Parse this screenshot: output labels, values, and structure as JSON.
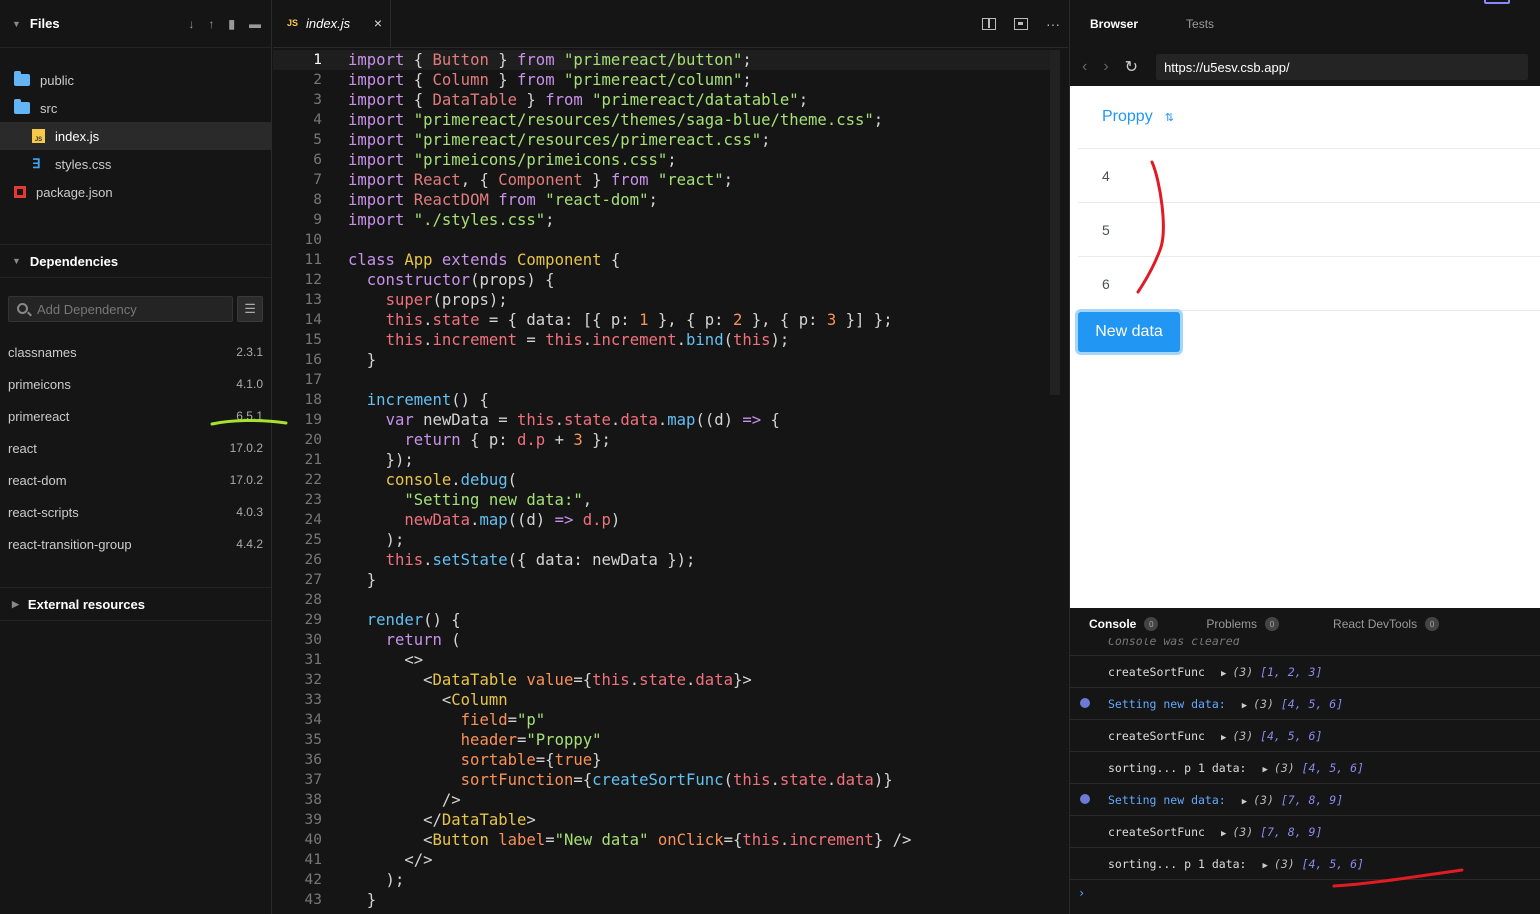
{
  "sidebar": {
    "files_title": "Files",
    "tree": [
      {
        "label": "public",
        "type": "folder"
      },
      {
        "label": "src",
        "type": "folder"
      },
      {
        "label": "index.js",
        "type": "js"
      },
      {
        "label": "styles.css",
        "type": "css"
      },
      {
        "label": "package.json",
        "type": "pkg"
      }
    ],
    "deps_title": "Dependencies",
    "dep_search_placeholder": "Add Dependency",
    "deps": [
      {
        "name": "classnames",
        "version": "2.3.1"
      },
      {
        "name": "primeicons",
        "version": "4.1.0"
      },
      {
        "name": "primereact",
        "version": "6.5.1"
      },
      {
        "name": "react",
        "version": "17.0.2"
      },
      {
        "name": "react-dom",
        "version": "17.0.2"
      },
      {
        "name": "react-scripts",
        "version": "4.0.3"
      },
      {
        "name": "react-transition-group",
        "version": "4.4.2"
      }
    ],
    "external_title": "External resources"
  },
  "editor": {
    "tab_badge": "JS",
    "tab_label": "index.js",
    "close_glyph": "×",
    "more_glyph": "···",
    "line_numbers": [
      "1",
      "2",
      "3",
      "4",
      "5",
      "6",
      "7",
      "8",
      "9",
      "10",
      "11",
      "12",
      "13",
      "14",
      "15",
      "16",
      "17",
      "18",
      "19",
      "20",
      "21",
      "22",
      "23",
      "24",
      "25",
      "26",
      "27",
      "28",
      "29",
      "30",
      "31",
      "32",
      "33",
      "34",
      "35",
      "36",
      "37",
      "38",
      "39",
      "40",
      "41",
      "42",
      "43"
    ]
  },
  "browser": {
    "tabs": [
      "Browser",
      "Tests"
    ],
    "url": "https://u5esv.csb.app/",
    "column_header": "Proppy",
    "rows": [
      "4",
      "5",
      "6"
    ],
    "button_label": "New data",
    "console_tabs": [
      {
        "label": "Console",
        "count": "0"
      },
      {
        "label": "Problems",
        "count": "0"
      },
      {
        "label": "React DevTools",
        "count": "0"
      }
    ],
    "console_cleared": "Console was cleared",
    "console_rows": [
      {
        "msg": "createSortFunc",
        "arr": "[1, 2, 3]",
        "debug": false
      },
      {
        "msg": "Setting new data:",
        "arr": "[4, 5, 6]",
        "debug": true
      },
      {
        "msg": "createSortFunc",
        "arr": "[4, 5, 6]",
        "debug": false
      },
      {
        "msg": "sorting...  p  1 data:",
        "arr": "[4, 5, 6]",
        "debug": false
      },
      {
        "msg": "Setting new data:",
        "arr": "[7, 8, 9]",
        "debug": true
      },
      {
        "msg": "createSortFunc",
        "arr": "[7, 8, 9]",
        "debug": false
      },
      {
        "msg": "sorting...  p  1 data:",
        "arr": "[4, 5, 6]",
        "debug": false
      }
    ],
    "arr_count": "(3)",
    "prompt": "›"
  },
  "colors": {
    "accent": "#2196f3",
    "annotation_red": "#e01b24",
    "annotation_green": "#a6e22e"
  }
}
